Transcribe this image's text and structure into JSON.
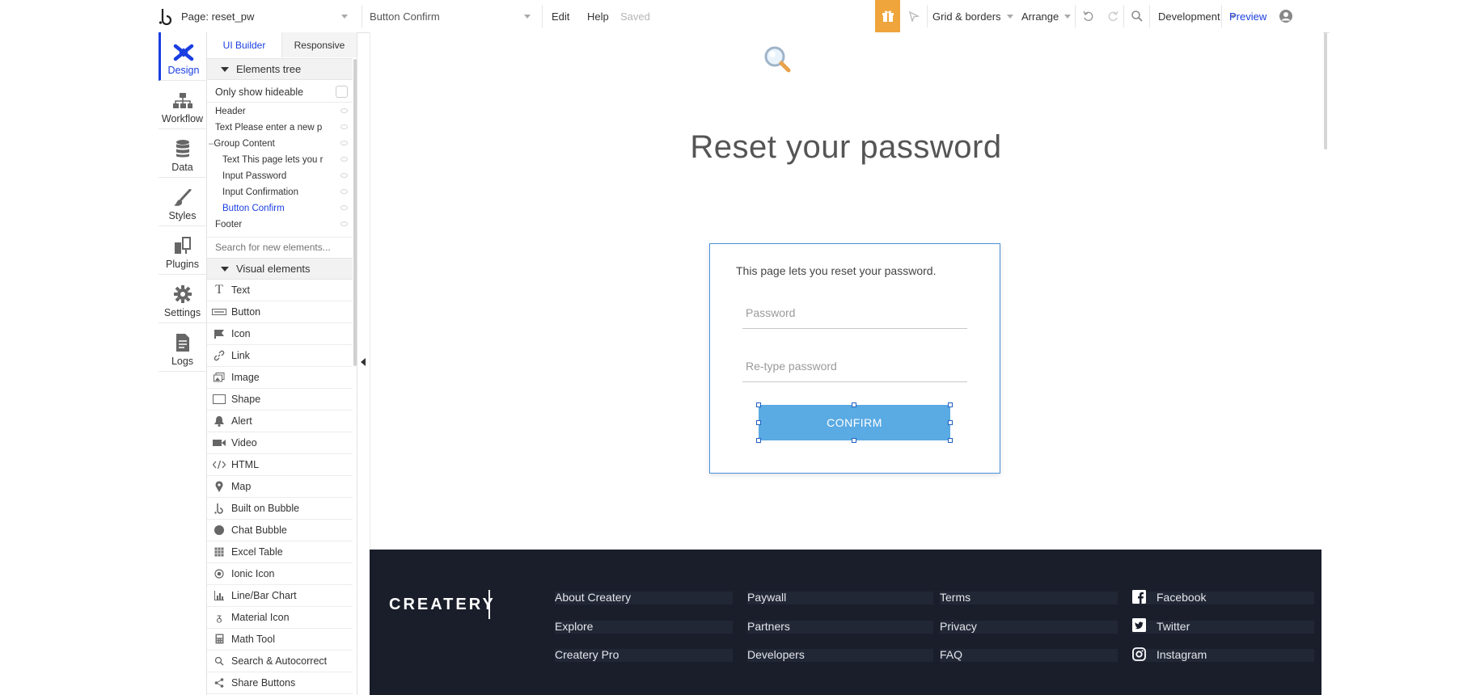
{
  "topbar": {
    "page_label": "Page: reset_pw",
    "element_label": "Button Confirm",
    "menu_edit": "Edit",
    "menu_help": "Help",
    "saved_status": "Saved",
    "grid_borders": "Grid & borders",
    "arrange": "Arrange",
    "environment": "Development",
    "preview": "Preview"
  },
  "leftnav": {
    "items": [
      {
        "label": "Design",
        "icon": "design-icon",
        "active": true
      },
      {
        "label": "Workflow",
        "icon": "workflow-icon"
      },
      {
        "label": "Data",
        "icon": "database-icon"
      },
      {
        "label": "Styles",
        "icon": "brush-icon"
      },
      {
        "label": "Plugins",
        "icon": "plug-icon"
      },
      {
        "label": "Settings",
        "icon": "gear-icon"
      },
      {
        "label": "Logs",
        "icon": "document-icon"
      }
    ]
  },
  "panel": {
    "tabs": [
      "UI Builder",
      "Responsive"
    ],
    "elements_tree_title": "Elements tree",
    "only_show_hideable": "Only show hideable",
    "tree": [
      "Header",
      "Text Please enter a new p",
      "Group Content",
      "Text This page lets you r",
      "Input Password",
      "Input Confirmation",
      "Button Confirm",
      "Footer"
    ],
    "search_placeholder": "Search for new elements...",
    "visual_elements_title": "Visual elements",
    "visual_elements": [
      {
        "label": "Text",
        "icon": "text-icon"
      },
      {
        "label": "Button",
        "icon": "button-icon"
      },
      {
        "label": "Icon",
        "icon": "flag-icon"
      },
      {
        "label": "Link",
        "icon": "link-icon"
      },
      {
        "label": "Image",
        "icon": "image-icon"
      },
      {
        "label": "Shape",
        "icon": "shape-icon"
      },
      {
        "label": "Alert",
        "icon": "bell-icon"
      },
      {
        "label": "Video",
        "icon": "video-icon"
      },
      {
        "label": "HTML",
        "icon": "code-icon"
      },
      {
        "label": "Map",
        "icon": "map-pin-icon"
      },
      {
        "label": "Built on Bubble",
        "icon": "bubble-logo-icon"
      },
      {
        "label": "Chat Bubble",
        "icon": "chat-bubble-icon"
      },
      {
        "label": "Excel Table",
        "icon": "table-icon"
      },
      {
        "label": "Ionic Icon",
        "icon": "ionic-icon"
      },
      {
        "label": "Line/Bar Chart",
        "icon": "chart-icon"
      },
      {
        "label": "Material Icon",
        "icon": "material-icon"
      },
      {
        "label": "Math Tool",
        "icon": "calculator-icon"
      },
      {
        "label": "Search & Autocorrect",
        "icon": "search-icon"
      },
      {
        "label": "Share Buttons",
        "icon": "share-icon"
      }
    ]
  },
  "canvas": {
    "heading": "Reset your password",
    "card_text": "This page lets you reset your password.",
    "password_placeholder": "Password",
    "retype_placeholder": "Re-type password",
    "confirm_label": "CONFIRM"
  },
  "footer": {
    "brand": "CREATERY",
    "col1": [
      "About Createry",
      "Explore",
      "Createry Pro"
    ],
    "col2": [
      "Paywall",
      "Partners",
      "Developers"
    ],
    "col3": [
      "Terms",
      "Privacy",
      "FAQ"
    ],
    "social": [
      {
        "label": "Facebook",
        "icon": "facebook-icon"
      },
      {
        "label": "Twitter",
        "icon": "twitter-icon"
      },
      {
        "label": "Instagram",
        "icon": "instagram-icon"
      }
    ]
  },
  "colors": {
    "accent": "#1a3ee0",
    "button": "#5aaae3",
    "footer_bg": "#1a1e2b",
    "gift": "#f0a43c"
  }
}
